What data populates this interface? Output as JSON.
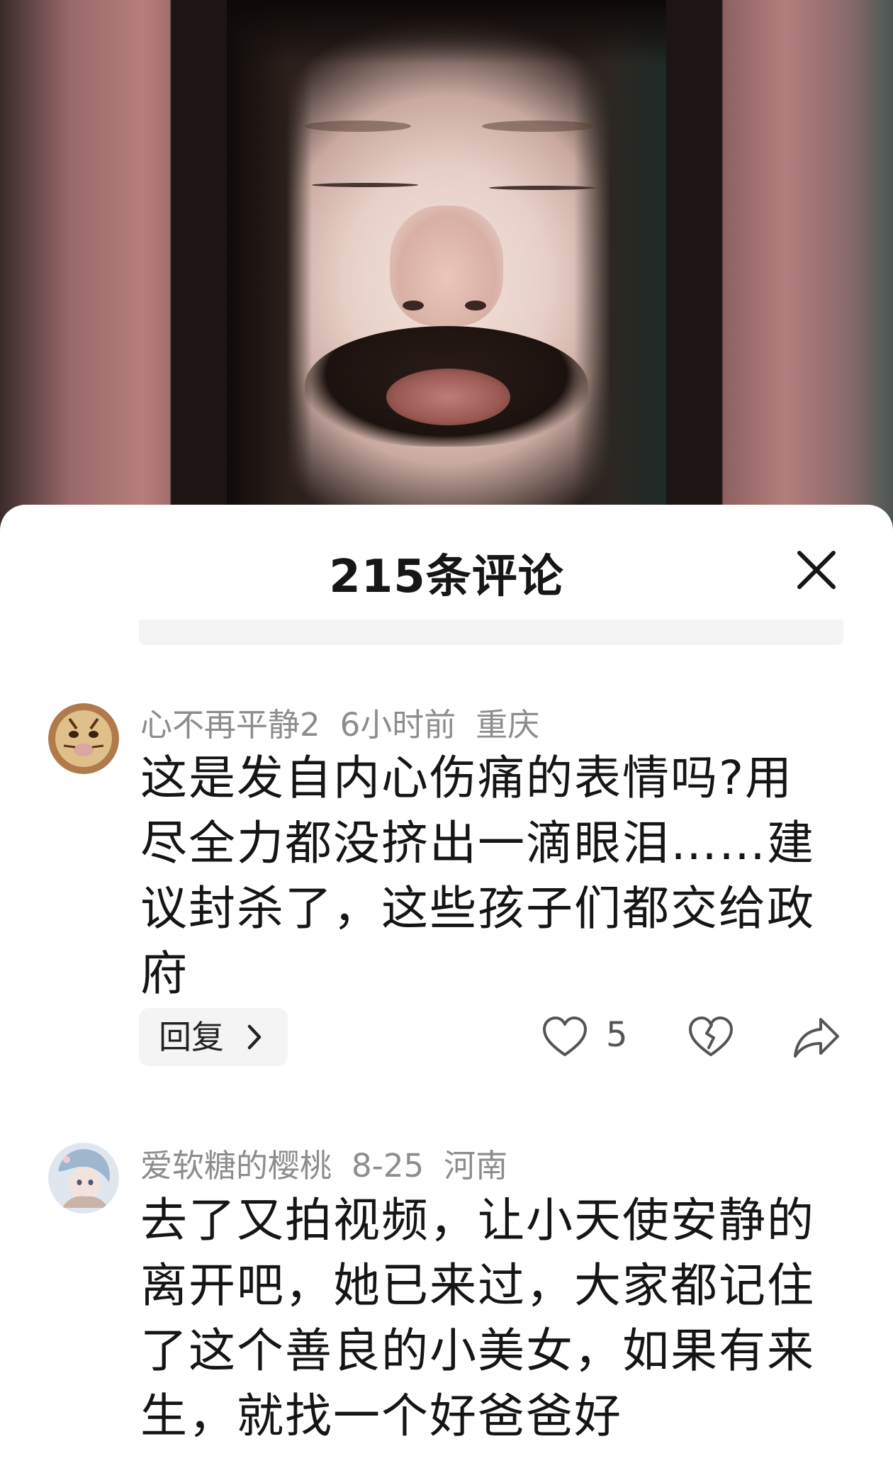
{
  "comments_panel": {
    "title": "215条评论",
    "close_icon": "close-icon"
  },
  "comments": [
    {
      "username": "心不再平静2",
      "time": "6小时前",
      "location": "重庆",
      "text": "这是发自内心伤痛的表情吗?用尽全力都没挤出一滴眼泪……建议封杀了，这些孩子们都交给政府",
      "reply_label": "回复",
      "like_count": "5",
      "icons": [
        "heart-icon",
        "broken-heart-icon",
        "share-icon"
      ]
    },
    {
      "username": "爱软糖的樱桃",
      "time": "8-25",
      "location": "河南",
      "text": "去了又拍视频，让小天使安静的离开吧，她已来过，大家都记住了这个善良的小美女，如果有来生，就找一个好爸爸好"
    }
  ],
  "colors": {
    "text_primary": "#151515",
    "text_meta": "#8d8d8d",
    "chip_bg": "#f4f4f4"
  }
}
